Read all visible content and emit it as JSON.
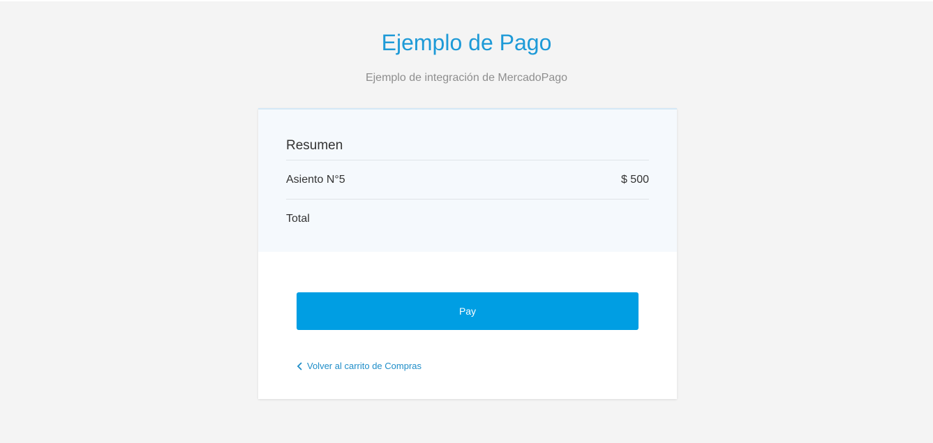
{
  "header": {
    "title": "Ejemplo de Pago",
    "subtitle": "Ejemplo de integración de MercadoPago"
  },
  "summary": {
    "title": "Resumen",
    "items": [
      {
        "label": "Asiento N°5",
        "price": "$ 500"
      }
    ],
    "total_label": "Total",
    "total_value": ""
  },
  "actions": {
    "pay_label": "Pay",
    "back_label": "Volver al carrito de Compras",
    "back_icon": "chevron-left-icon"
  },
  "colors": {
    "accent": "#009ee3",
    "title": "#1e9ad7",
    "background": "#f4f4f4",
    "summary_bg": "#f5f9fd"
  }
}
